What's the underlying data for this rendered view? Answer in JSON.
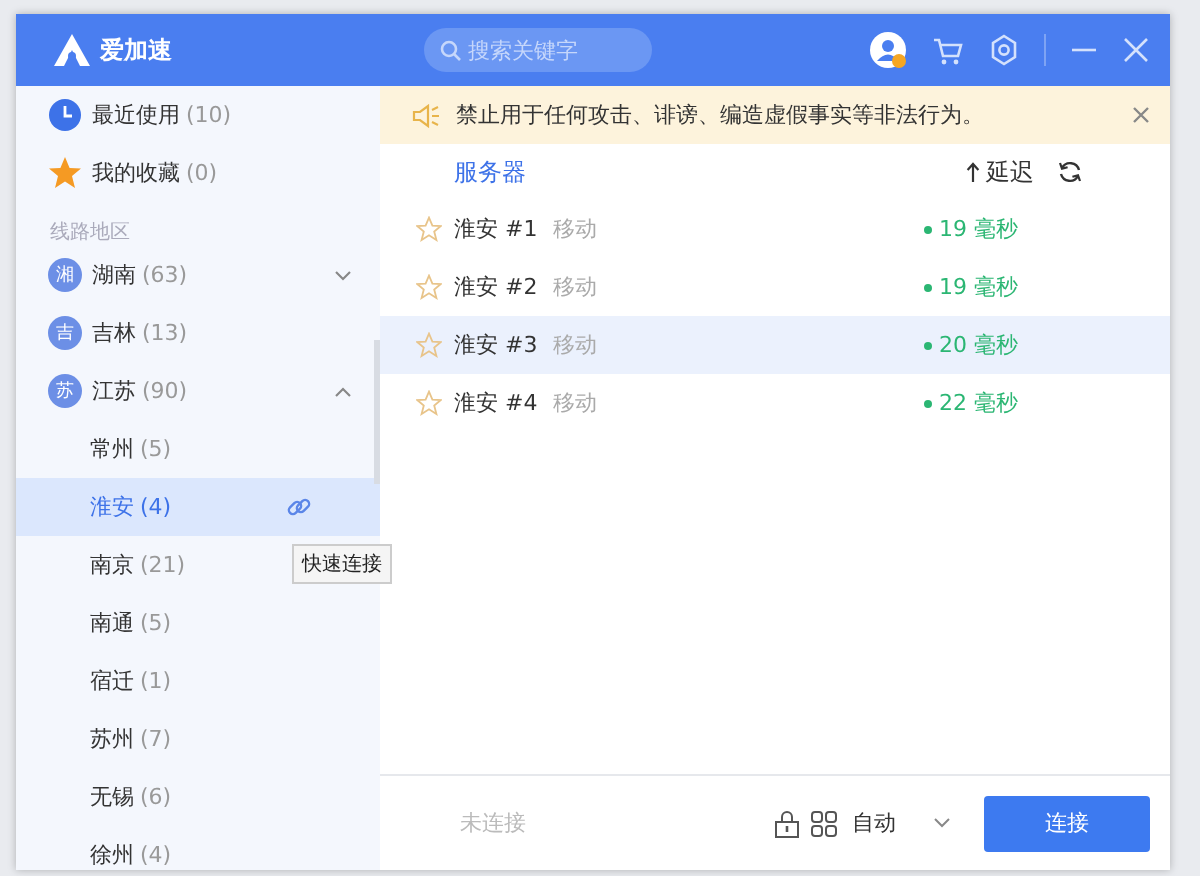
{
  "app": {
    "name": "爱加速"
  },
  "search": {
    "placeholder": "搜索关键字"
  },
  "sidebar": {
    "items": [
      {
        "kind": "recent",
        "label": "最近使用",
        "count": "(10)"
      },
      {
        "kind": "favorite",
        "label": "我的收藏",
        "count": "(0)"
      }
    ],
    "section_label": "线路地区",
    "regions": [
      {
        "badge": "湘",
        "label": "湖南",
        "count": "(63)",
        "expanded": false
      },
      {
        "badge": "吉",
        "label": "吉林",
        "count": "(13)"
      },
      {
        "badge": "苏",
        "label": "江苏",
        "count": "(90)",
        "expanded": true,
        "children": [
          {
            "label": "常州",
            "count": "(5)",
            "selected": false
          },
          {
            "label": "淮安",
            "count": "(4)",
            "selected": true,
            "tooltip": "快速连接"
          },
          {
            "label": "南京",
            "count": "(21)",
            "selected": false
          },
          {
            "label": "南通",
            "count": "(5)",
            "selected": false
          },
          {
            "label": "宿迁",
            "count": "(1)",
            "selected": false
          },
          {
            "label": "苏州",
            "count": "(7)",
            "selected": false
          },
          {
            "label": "无锡",
            "count": "(6)",
            "selected": false
          },
          {
            "label": "徐州",
            "count": "(4)",
            "selected": false
          }
        ]
      }
    ]
  },
  "notice": {
    "text": "禁止用于任何攻击、诽谤、编造虚假事实等非法行为。"
  },
  "server_list": {
    "columns": [
      "服务器",
      "延迟"
    ],
    "rows": [
      {
        "name": "淮安 #1",
        "carrier": "移动",
        "latency": "19 毫秒",
        "favorite": false,
        "selected": false
      },
      {
        "name": "淮安 #2",
        "carrier": "移动",
        "latency": "19 毫秒",
        "favorite": false,
        "selected": false
      },
      {
        "name": "淮安 #3",
        "carrier": "移动",
        "latency": "20 毫秒",
        "favorite": false,
        "selected": true
      },
      {
        "name": "淮安 #4",
        "carrier": "移动",
        "latency": "22 毫秒",
        "favorite": false,
        "selected": false
      }
    ]
  },
  "footer": {
    "status": "未连接",
    "mode": "自动",
    "connect_button": "连接"
  }
}
